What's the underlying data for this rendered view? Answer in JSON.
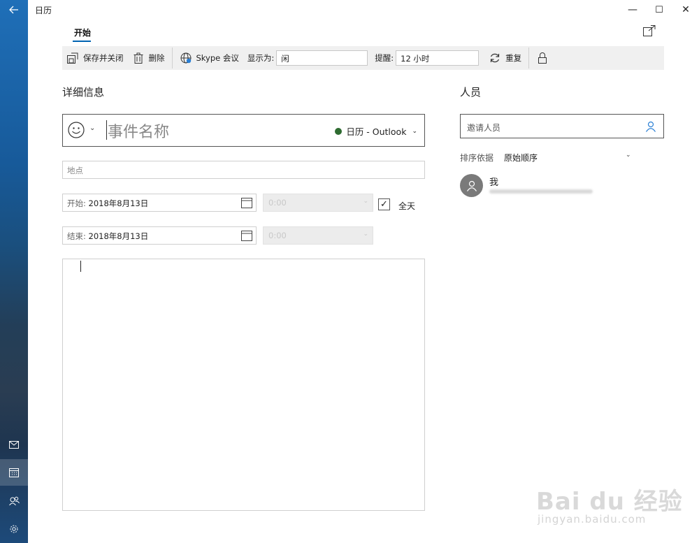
{
  "window": {
    "title": "日历",
    "back_icon": "back-arrow-icon",
    "minimize_glyph": "—",
    "maximize_glyph": "☐",
    "close_glyph": "✕"
  },
  "rail": {
    "items": [
      {
        "name": "mail-icon"
      },
      {
        "name": "calendar-icon",
        "active": true
      },
      {
        "name": "people-icon"
      },
      {
        "name": "settings-icon"
      }
    ]
  },
  "tabs": {
    "home_label": "开始"
  },
  "toolbar": {
    "save_close_label": "保存并关闭",
    "delete_label": "删除",
    "skype_label": "Skype 会议",
    "show_as_label": "显示为:",
    "show_as_value": "闲",
    "reminder_label": "提醒:",
    "reminder_value": "12 小时",
    "repeat_label": "重复"
  },
  "details": {
    "heading": "详细信息",
    "event_name_placeholder": "事件名称",
    "calendar_name": "日历 - Outlook",
    "calendar_color": "#2e6b30",
    "location_placeholder": "地点",
    "start_label": "开始:",
    "start_date": "2018年8月13日",
    "start_time": "0:00",
    "end_label": "结束:",
    "end_date": "2018年8月13日",
    "end_time": "0:00",
    "all_day_label": "全天",
    "all_day_checked": true
  },
  "people": {
    "heading": "人员",
    "invite_placeholder": "邀请人员",
    "sort_label": "排序依据",
    "sort_value": "原始顺序",
    "attendees": [
      {
        "name": "我"
      }
    ]
  },
  "watermark": {
    "main": "Bai du 经验",
    "sub": "jingyan.baidu.com"
  }
}
